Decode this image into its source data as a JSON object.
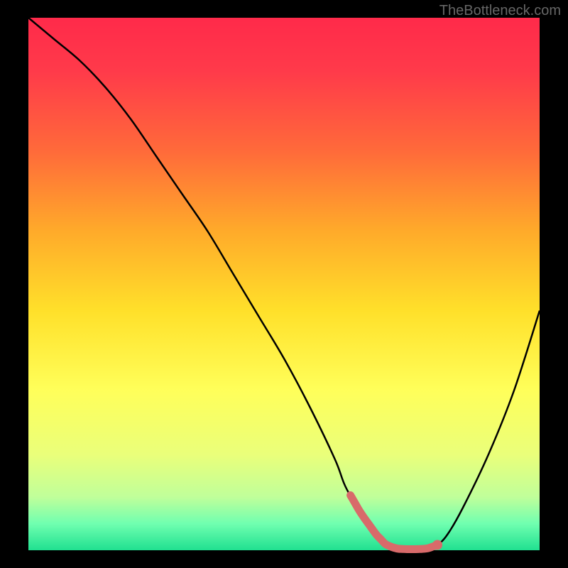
{
  "watermark": "TheBottleneck.com",
  "chart_data": {
    "type": "line",
    "title": "",
    "xlabel": "",
    "ylabel": "",
    "xlim": [
      0,
      100
    ],
    "ylim": [
      0,
      100
    ],
    "series": [
      {
        "name": "bottleneck-curve",
        "x": [
          0,
          5,
          10,
          15,
          20,
          25,
          30,
          35,
          40,
          45,
          50,
          55,
          60,
          62,
          65,
          68,
          70,
          72,
          74,
          76,
          78,
          80,
          82,
          85,
          90,
          95,
          100
        ],
        "values": [
          100,
          96,
          92,
          87,
          81,
          74,
          67,
          60,
          52,
          44,
          36,
          27,
          17,
          12,
          7,
          3,
          1,
          0.3,
          0.2,
          0.2,
          0.3,
          1,
          3,
          8,
          18,
          30,
          45
        ]
      }
    ],
    "highlight": {
      "name": "optimal-range",
      "x_start": 63,
      "x_end": 80,
      "marker_x": 80,
      "color": "#d86a6a"
    },
    "gradient_stops": [
      {
        "pos": 0,
        "color": "#ff2a4a"
      },
      {
        "pos": 55,
        "color": "#ffe02a"
      },
      {
        "pos": 100,
        "color": "#20e090"
      }
    ]
  }
}
